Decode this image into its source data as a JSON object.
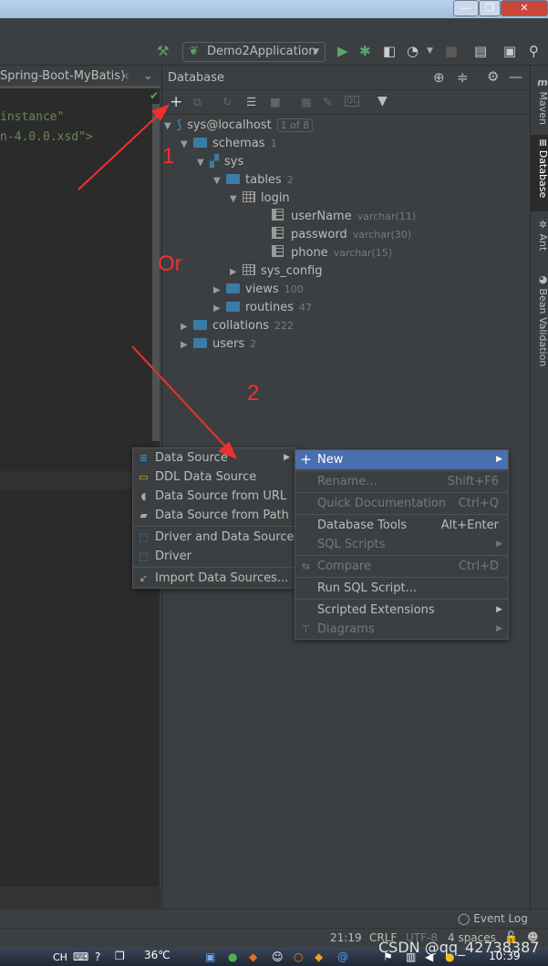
{
  "toolbar": {
    "run_config": "Demo2Application",
    "icons": [
      "build-hammer-icon",
      "run-icon",
      "debug-icon",
      "coverage-icon",
      "profile-icon",
      "stop-icon",
      "project-structure-icon",
      "terminal-icon",
      "search-icon"
    ]
  },
  "editor": {
    "tab_title": "Spring-Boot-MyBatis)",
    "code_lines": [
      "instance\"",
      "n-4.0.0.xsd\">"
    ]
  },
  "database": {
    "title": "Database",
    "tree": [
      {
        "label": "sys@localhost",
        "meta": "1 of 8"
      },
      {
        "label": "schemas",
        "meta": "1"
      },
      {
        "label": "sys",
        "meta": ""
      },
      {
        "label": "tables",
        "meta": "2"
      },
      {
        "label": "login",
        "meta": ""
      },
      {
        "label": "userName",
        "meta": "varchar(11)"
      },
      {
        "label": "password",
        "meta": "varchar(30)"
      },
      {
        "label": "phone",
        "meta": "varchar(15)"
      },
      {
        "label": "sys_config",
        "meta": ""
      },
      {
        "label": "views",
        "meta": "100"
      },
      {
        "label": "routines",
        "meta": "47"
      },
      {
        "label": "collations",
        "meta": "222"
      },
      {
        "label": "users",
        "meta": "2"
      }
    ]
  },
  "right_tabs": [
    "Maven",
    "Database",
    "Ant",
    "Bean Validation"
  ],
  "submenu": [
    {
      "label": "Data Source",
      "icon": "database-icon"
    },
    {
      "label": "DDL Data Source",
      "icon": "ddl-icon"
    },
    {
      "label": "Data Source from URL",
      "icon": "plug-icon"
    },
    {
      "label": "Data Source from Path",
      "icon": "folder-open-icon"
    },
    {
      "label": "Driver and Data Source",
      "icon": "driver-icon"
    },
    {
      "label": "Driver",
      "icon": "driver-icon"
    },
    {
      "label": "Import Data Sources...",
      "icon": "import-icon"
    }
  ],
  "context_menu": [
    {
      "label": "New",
      "shortcut": ""
    },
    {
      "label": "Rename...",
      "shortcut": "Shift+F6"
    },
    {
      "label": "Quick Documentation",
      "shortcut": "Ctrl+Q"
    },
    {
      "label": "Database Tools",
      "shortcut": "Alt+Enter"
    },
    {
      "label": "SQL Scripts",
      "shortcut": ""
    },
    {
      "label": "Compare",
      "shortcut": "Ctrl+D"
    },
    {
      "label": "Run SQL Script...",
      "shortcut": ""
    },
    {
      "label": "Scripted Extensions",
      "shortcut": ""
    },
    {
      "label": "Diagrams",
      "shortcut": ""
    }
  ],
  "annotations": {
    "one": "1",
    "or": "Or",
    "two": "2",
    "color": "#f03030"
  },
  "event_log": "Event Log",
  "status": {
    "position": "21:19",
    "line_sep": "CRLF",
    "encoding": "UTF-8",
    "indent": "4 spaces"
  },
  "taskbar": {
    "lang": "CH",
    "temp": "36℃",
    "time": "10:39"
  },
  "watermark": "CSDN @qq_42738387"
}
